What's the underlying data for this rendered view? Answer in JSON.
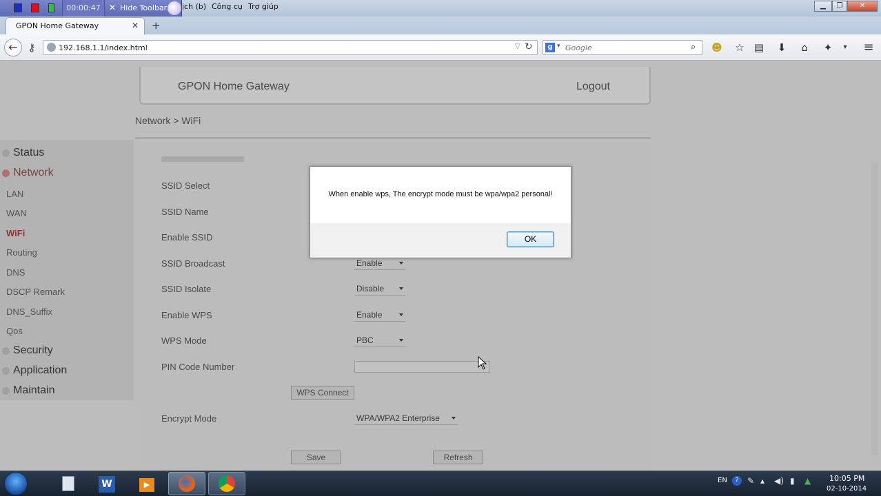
{
  "recorder": {
    "timer": "00:00:47",
    "hide_label": "Hide Toolbar"
  },
  "menubar": {
    "items": [
      "ịch (b)",
      "Công cụ",
      "Trợ giúp"
    ]
  },
  "window_controls": {
    "minimize": "▁",
    "maximize": "❐",
    "close": "✕"
  },
  "browser": {
    "tab_title": "GPON Home Gateway",
    "tab_close": "✕",
    "new_tab": "+",
    "url": "192.168.1.1/index.html",
    "search_engine": "Google",
    "search_placeholder": "Google",
    "icons": [
      "back-icon",
      "key-icon",
      "globe-icon",
      "reload-icon",
      "google-icon",
      "search-icon",
      "addon-icon",
      "star-icon",
      "reading-list-icon",
      "download-icon",
      "home-icon",
      "extension-icon",
      "menu-icon"
    ]
  },
  "page": {
    "header_title": "GPON Home Gateway",
    "logout_label": "Logout",
    "breadcrumb": "Network > WiFi",
    "nav": {
      "categories": [
        {
          "label": "Status"
        },
        {
          "label": "Network"
        },
        {
          "label": "Security"
        },
        {
          "label": "Application"
        },
        {
          "label": "Maintain"
        }
      ],
      "network_items": [
        "LAN",
        "WAN",
        "WiFi",
        "Routing",
        "DNS",
        "DSCP Remark",
        "DNS_Suffix",
        "Qos"
      ],
      "active_item": "WiFi"
    },
    "form": {
      "fields": [
        {
          "label": "SSID Select"
        },
        {
          "label": "SSID Name"
        },
        {
          "label": "Enable SSID"
        },
        {
          "label": "SSID Broadcast",
          "value": "Enable"
        },
        {
          "label": "SSID Isolate",
          "value": "Disable"
        },
        {
          "label": "Enable WPS",
          "value": "Enable"
        },
        {
          "label": "WPS Mode",
          "value": "PBC"
        },
        {
          "label": "PIN Code Number",
          "value": ""
        },
        {
          "label": "Encrypt Mode",
          "value": "WPA/WPA2 Enterprise"
        }
      ],
      "wps_connect_label": "WPS Connect",
      "save_label": "Save",
      "refresh_label": "Refresh"
    }
  },
  "dialog": {
    "message": "When enable wps, The encrypt mode must be wpa/wpa2 personal!",
    "ok_label": "OK"
  },
  "taskbar": {
    "apps": [
      "explorer-icon",
      "word-icon",
      "media-player-icon",
      "firefox-icon",
      "chrome-icon"
    ],
    "active_app": "firefox-icon",
    "tray_lang": "EN",
    "time": "10:05 PM",
    "date": "02-10-2014"
  },
  "colors": {
    "page_bg": "#bdbdbd",
    "active_nav": "#8a3535",
    "dialog_ok_border": "#3c7fb1",
    "taskbar": "#1e2a38"
  }
}
